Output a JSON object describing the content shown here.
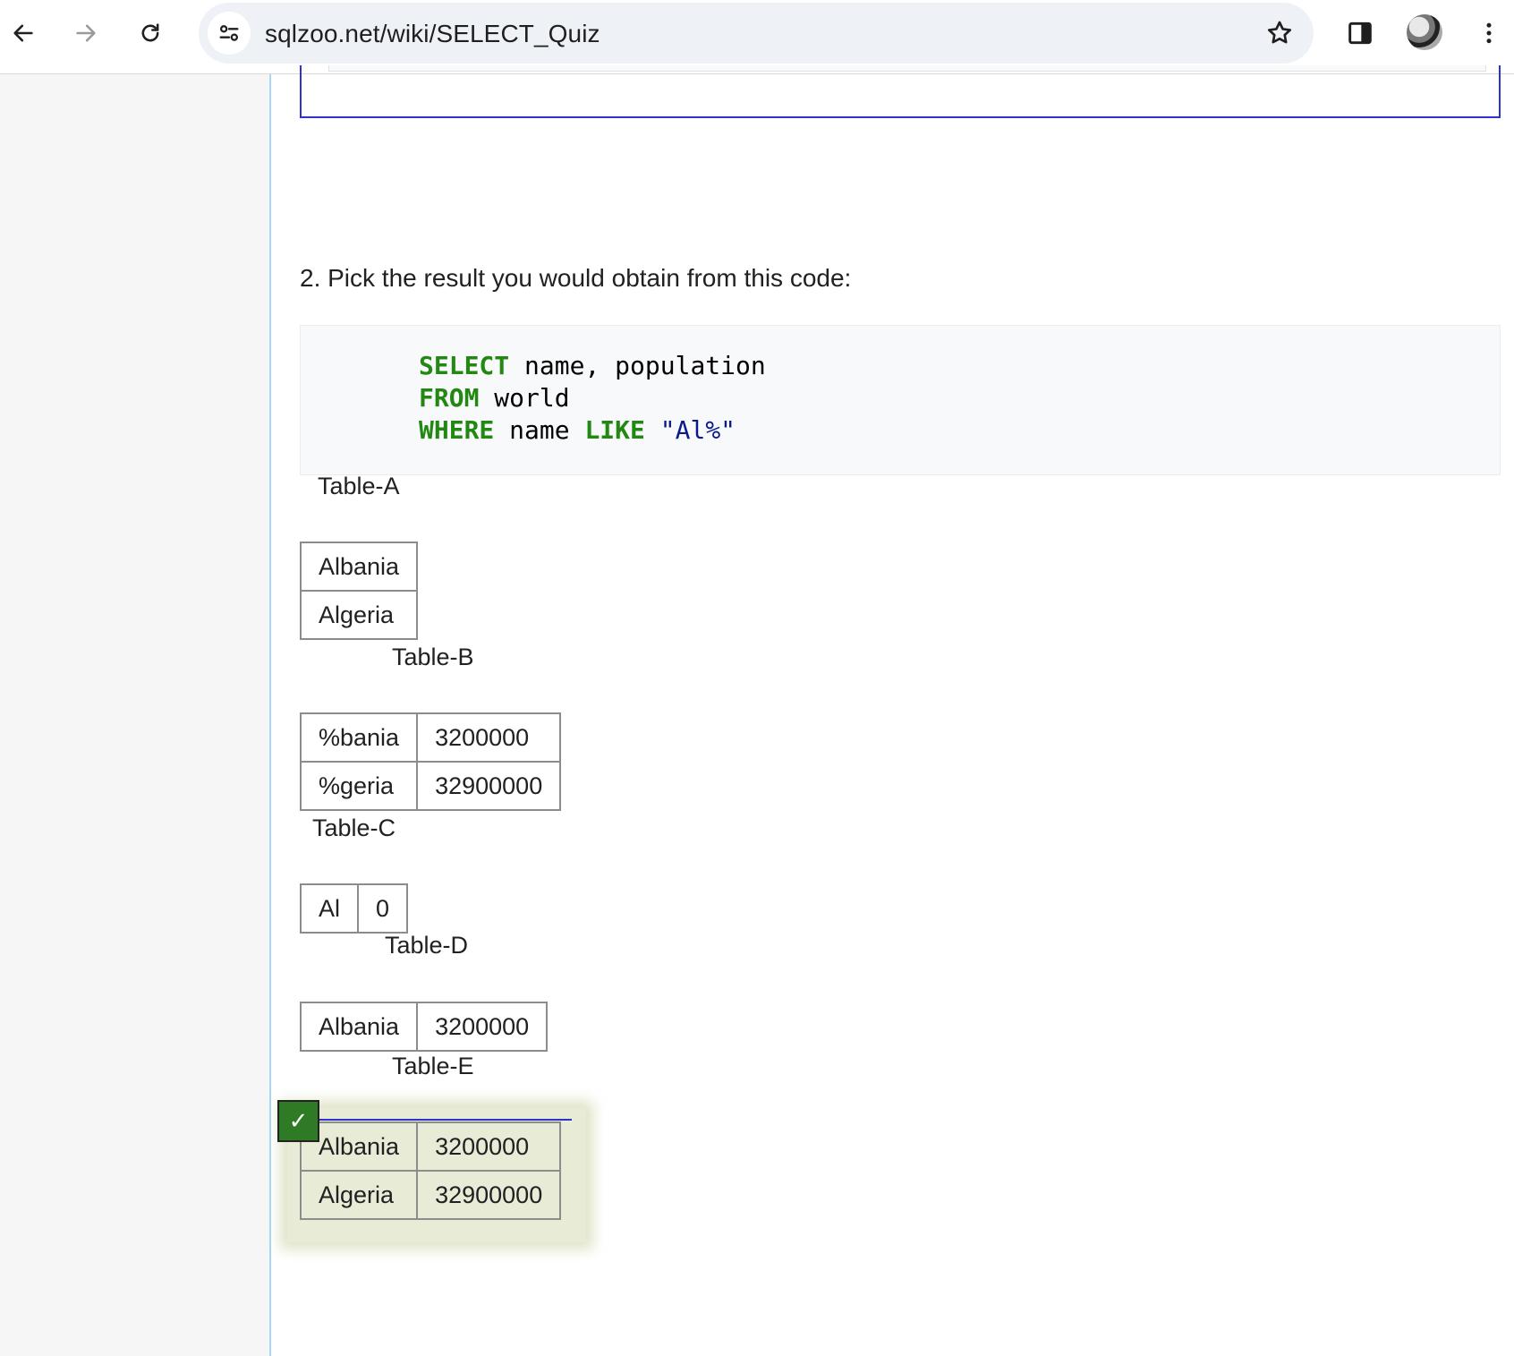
{
  "browser": {
    "url": "sqlzoo.net/wiki/SELECT_Quiz"
  },
  "question": {
    "text": "2. Pick the result you would obtain from this code:",
    "code": {
      "line1_kw": "SELECT",
      "line1_rest": " name, population",
      "line2_kw": "FROM",
      "line2_rest": " world",
      "line3_kw1": "WHERE",
      "line3_mid": " name ",
      "line3_kw2": "LIKE",
      "line3_str": "\"Al%\""
    }
  },
  "tables": {
    "a": {
      "label": "Table-A",
      "rows": [
        [
          "Albania"
        ],
        [
          "Algeria"
        ]
      ]
    },
    "b": {
      "label": "Table-B",
      "rows": [
        [
          "%bania",
          "3200000"
        ],
        [
          "%geria",
          "32900000"
        ]
      ]
    },
    "c": {
      "label": "Table-C",
      "rows": [
        [
          "Al",
          "0"
        ]
      ]
    },
    "d": {
      "label": "Table-D",
      "rows": [
        [
          "Albania",
          "3200000"
        ]
      ]
    },
    "e": {
      "label": "Table-E",
      "rows": [
        [
          "Albania",
          "3200000"
        ],
        [
          "Algeria",
          "32900000"
        ]
      ],
      "selected": true
    }
  },
  "answer_mark": {
    "glyph": "✓",
    "color": "#2f7a25"
  }
}
